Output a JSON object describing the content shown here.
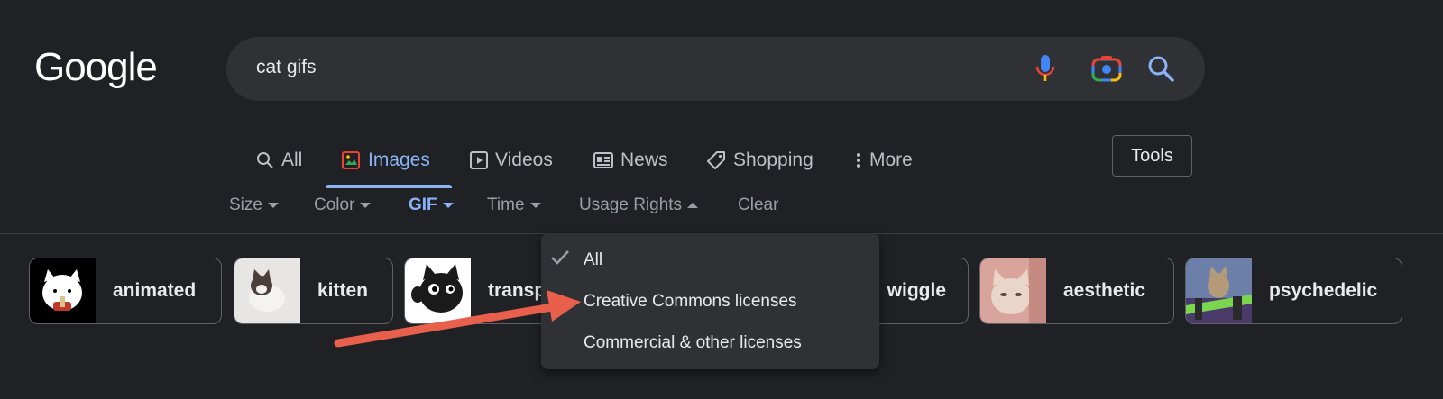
{
  "logo": "Google",
  "search": {
    "query": "cat gifs"
  },
  "tabs": [
    {
      "label": "All"
    },
    {
      "label": "Images"
    },
    {
      "label": "Videos"
    },
    {
      "label": "News"
    },
    {
      "label": "Shopping"
    },
    {
      "label": "More"
    }
  ],
  "tools_label": "Tools",
  "filters": {
    "size": "Size",
    "color": "Color",
    "gif": "GIF",
    "time": "Time",
    "usage_rights": "Usage Rights",
    "clear": "Clear"
  },
  "chips": [
    {
      "label": "animated"
    },
    {
      "label": "kitten"
    },
    {
      "label": "transp"
    },
    {
      "label": "wiggle"
    },
    {
      "label": "aesthetic"
    },
    {
      "label": "psychedelic"
    }
  ],
  "dropdown": {
    "items": [
      {
        "label": "All",
        "selected": true
      },
      {
        "label": "Creative Commons licenses",
        "selected": false
      },
      {
        "label": "Commercial & other licenses",
        "selected": false
      }
    ]
  },
  "colors": {
    "background": "#202124",
    "accent": "#8ab4f8",
    "annotation_arrow": "#e8604c"
  }
}
